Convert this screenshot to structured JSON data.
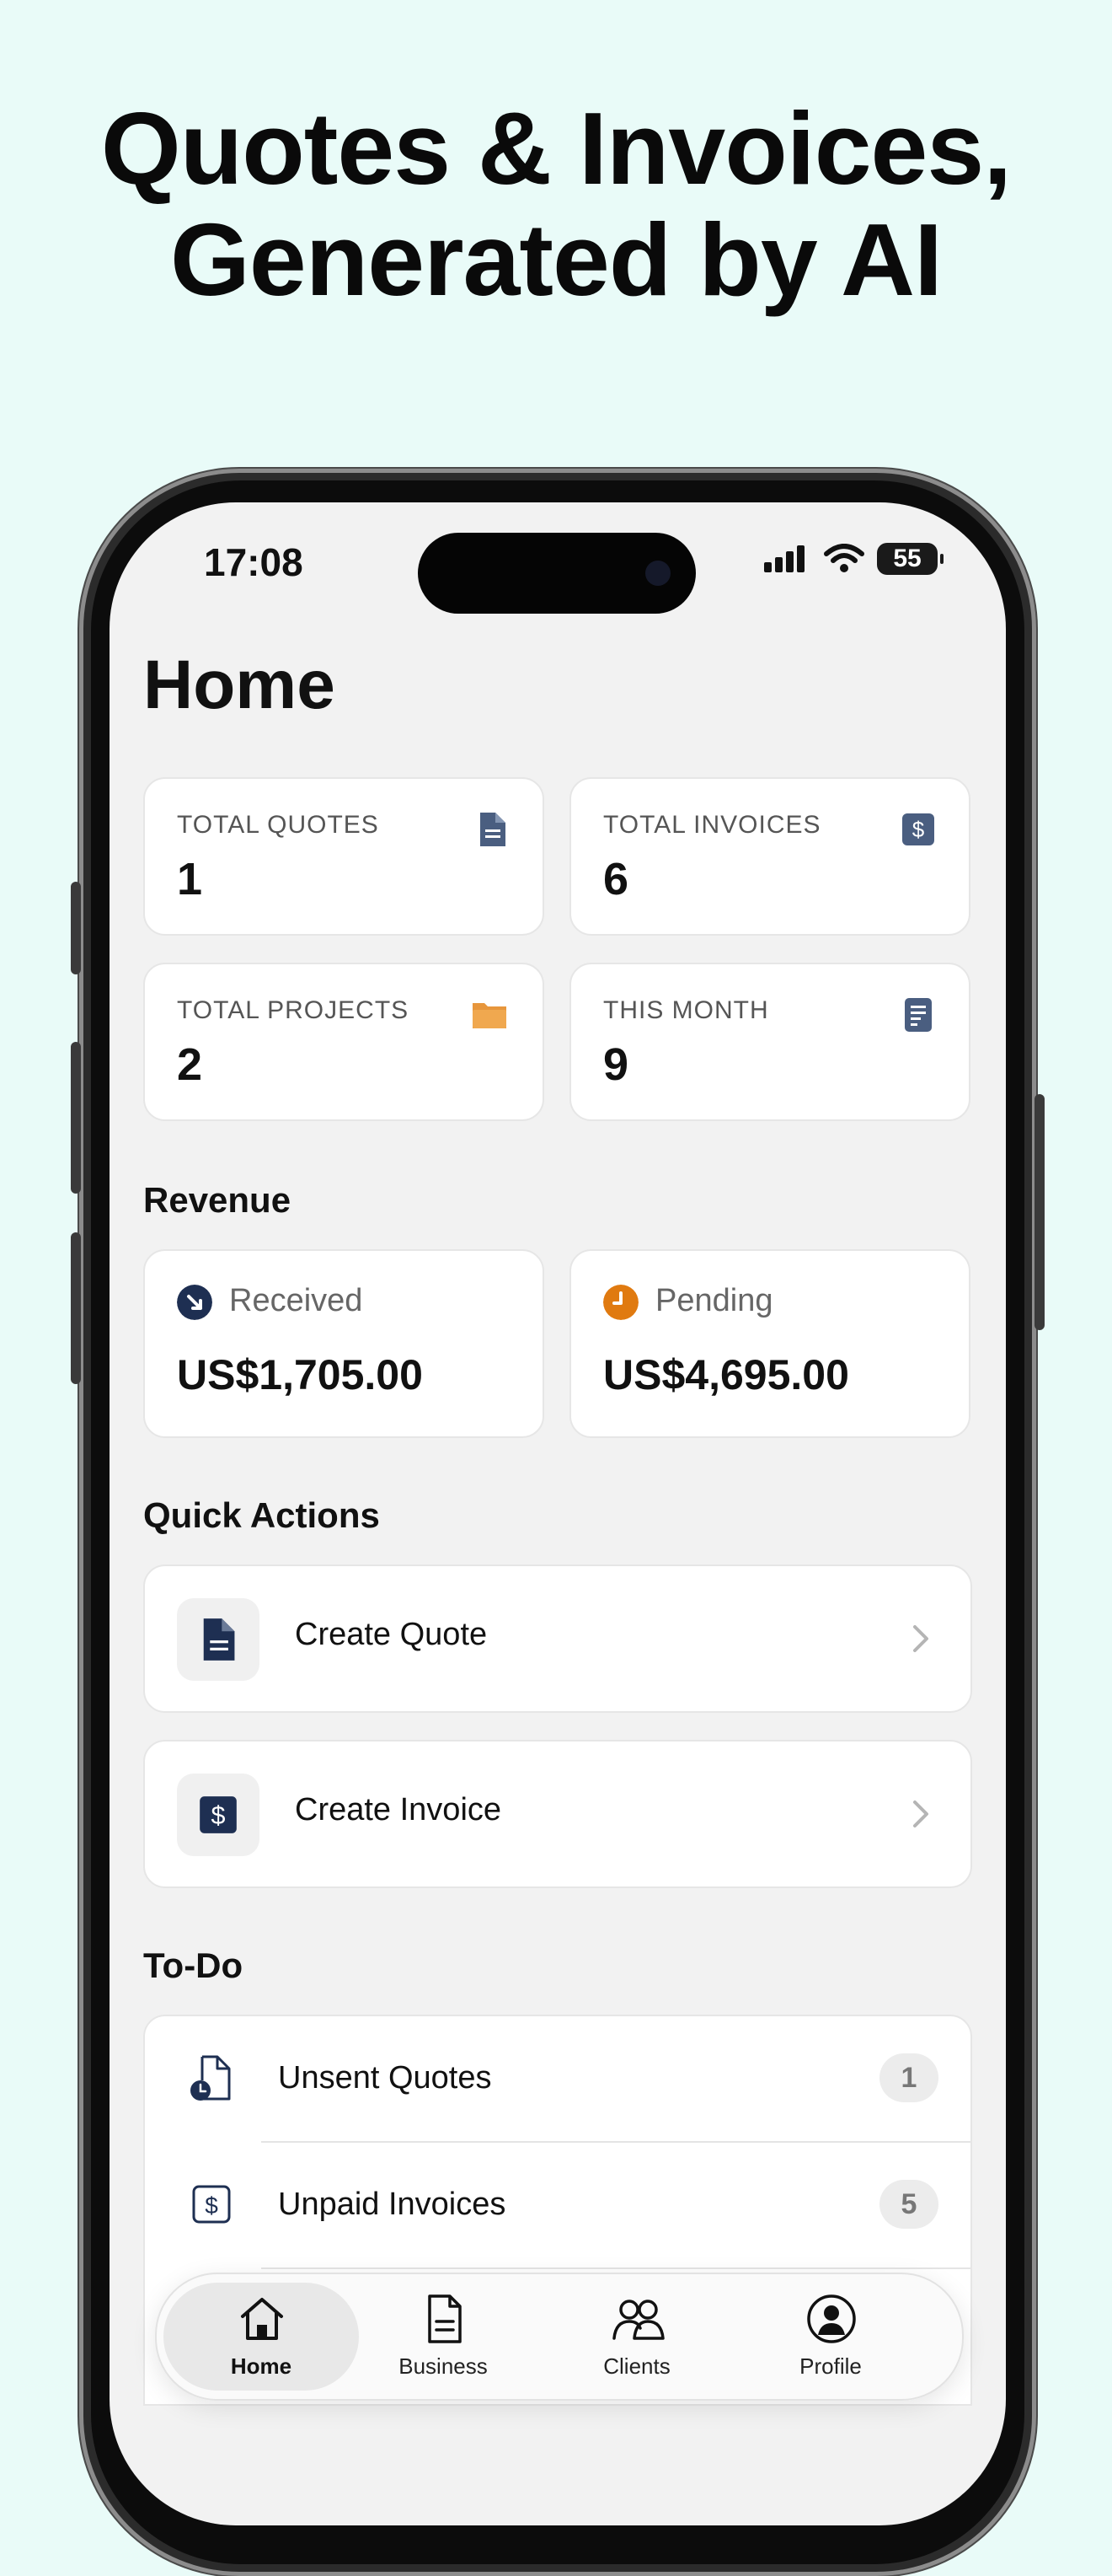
{
  "headline": {
    "line1": "Quotes & Invoices,",
    "line2": "Generated by AI"
  },
  "status_bar": {
    "time": "17:08",
    "battery": "55"
  },
  "page_title": "Home",
  "stats": [
    {
      "label": "TOTAL QUOTES",
      "value": "1",
      "icon": "document-icon",
      "color": "#4a5e80"
    },
    {
      "label": "TOTAL INVOICES",
      "value": "6",
      "icon": "dollar-icon",
      "color": "#4a5e80"
    },
    {
      "label": "TOTAL PROJECTS",
      "value": "2",
      "icon": "folder-icon",
      "color": "#e7963c"
    },
    {
      "label": "THIS MONTH",
      "value": "9",
      "icon": "list-icon",
      "color": "#4a5e80"
    }
  ],
  "revenue": {
    "title": "Revenue",
    "received": {
      "label": "Received",
      "value": "US$1,705.00",
      "color": "#1e2f52"
    },
    "pending": {
      "label": "Pending",
      "value": "US$4,695.00",
      "color": "#e07a10"
    }
  },
  "quick_actions": {
    "title": "Quick Actions",
    "items": [
      {
        "label": "Create Quote",
        "icon": "document-icon"
      },
      {
        "label": "Create Invoice",
        "icon": "dollar-icon"
      }
    ]
  },
  "todo": {
    "title": "To-Do",
    "items": [
      {
        "label": "Unsent Quotes",
        "count": "1",
        "icon": "unsent-quote-icon"
      },
      {
        "label": "Unpaid Invoices",
        "count": "5",
        "icon": "unpaid-invoice-icon"
      }
    ]
  },
  "tabbar": {
    "items": [
      {
        "label": "Home",
        "icon": "home-icon",
        "active": true
      },
      {
        "label": "Business",
        "icon": "business-icon",
        "active": false
      },
      {
        "label": "Clients",
        "icon": "clients-icon",
        "active": false
      },
      {
        "label": "Profile",
        "icon": "profile-icon",
        "active": false
      }
    ]
  }
}
